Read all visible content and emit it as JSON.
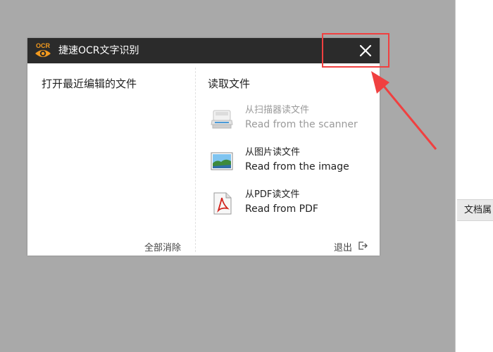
{
  "dialog": {
    "title": "捷速OCR文字识别",
    "logo_text": "OCR",
    "close_icon": "close-icon",
    "accent_color": "#f39a1e",
    "titlebar_color": "#2b2b2b"
  },
  "recent": {
    "heading": "打开最近编辑的文件",
    "clear_all_label": "全部消除"
  },
  "read": {
    "heading": "读取文件",
    "options": [
      {
        "cn": "从扫描器读文件",
        "en": "Read from the scanner",
        "icon": "scanner-icon",
        "enabled": false
      },
      {
        "cn": "从图片读文件",
        "en": "Read from the image",
        "icon": "image-icon",
        "enabled": true
      },
      {
        "cn": "从PDF读文件",
        "en": "Read from PDF",
        "icon": "pdf-icon",
        "enabled": true
      }
    ],
    "exit_label": "退出",
    "exit_icon": "exit-icon"
  },
  "background_app": {
    "tab_label": "文档属"
  },
  "annotation": {
    "color": "#f04040"
  }
}
